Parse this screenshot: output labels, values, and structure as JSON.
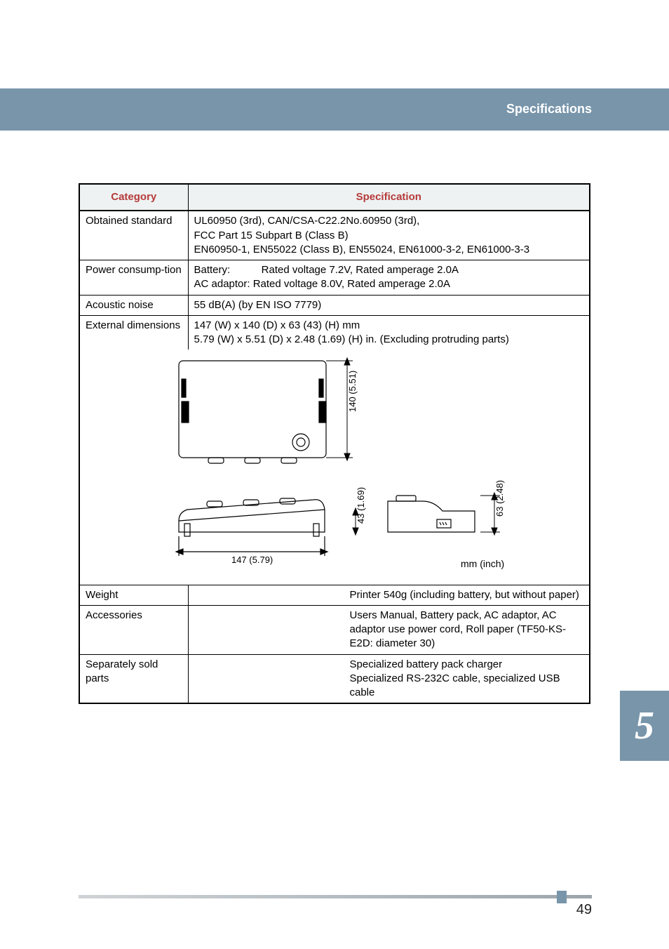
{
  "header": {
    "title": "Specifications"
  },
  "table": {
    "headers": {
      "col1": "Category",
      "col2": "Specification"
    },
    "rows": {
      "obtained": {
        "label": "Obtained standard",
        "lines": [
          "UL60950 (3rd), CAN/CSA-C22.2No.60950 (3rd),",
          "FCC Part 15 Subpart B (Class B)",
          "EN60950-1, EN55022 (Class B), EN55024, EN61000-3-2, EN61000-3-3"
        ]
      },
      "power": {
        "label": "Power consump-tion",
        "l1a": "Battery:",
        "l1b": "Rated voltage 7.2V, Rated amperage 2.0A",
        "l2": "AC adaptor: Rated voltage 8.0V, Rated amperage 2.0A"
      },
      "acoustic": {
        "label": "Acoustic noise",
        "value": "55 dB(A) (by EN ISO 7779)"
      },
      "dimensions": {
        "label": "External dimensions",
        "l1": "147 (W) x 140 (D) x 63 (43) (H) mm",
        "l2": "5.79 (W) x 5.51 (D) x 2.48 (1.69) (H) in. (Excluding protruding parts)"
      },
      "weight": {
        "label": "Weight",
        "value": "Printer 540g (including battery, but without paper)"
      },
      "accessories": {
        "label": "Accessories",
        "value": "Users Manual, Battery pack, AC adaptor, AC adaptor use power cord, Roll paper (TF50-KS-E2D: diameter 30)"
      },
      "separate": {
        "label": "Separately sold parts",
        "l1": "Specialized battery pack charger",
        "l2": "Specialized RS-232C cable, specialized USB cable"
      }
    }
  },
  "diagram": {
    "dim_depth": "140 (5.51)",
    "dim_width": "147 (5.79)",
    "dim_h1": "43 (1.69)",
    "dim_h2": "63 (2.48)",
    "unit": "mm (inch)"
  },
  "side_tab": {
    "chapter": "5"
  },
  "footer": {
    "page_num": "49"
  }
}
